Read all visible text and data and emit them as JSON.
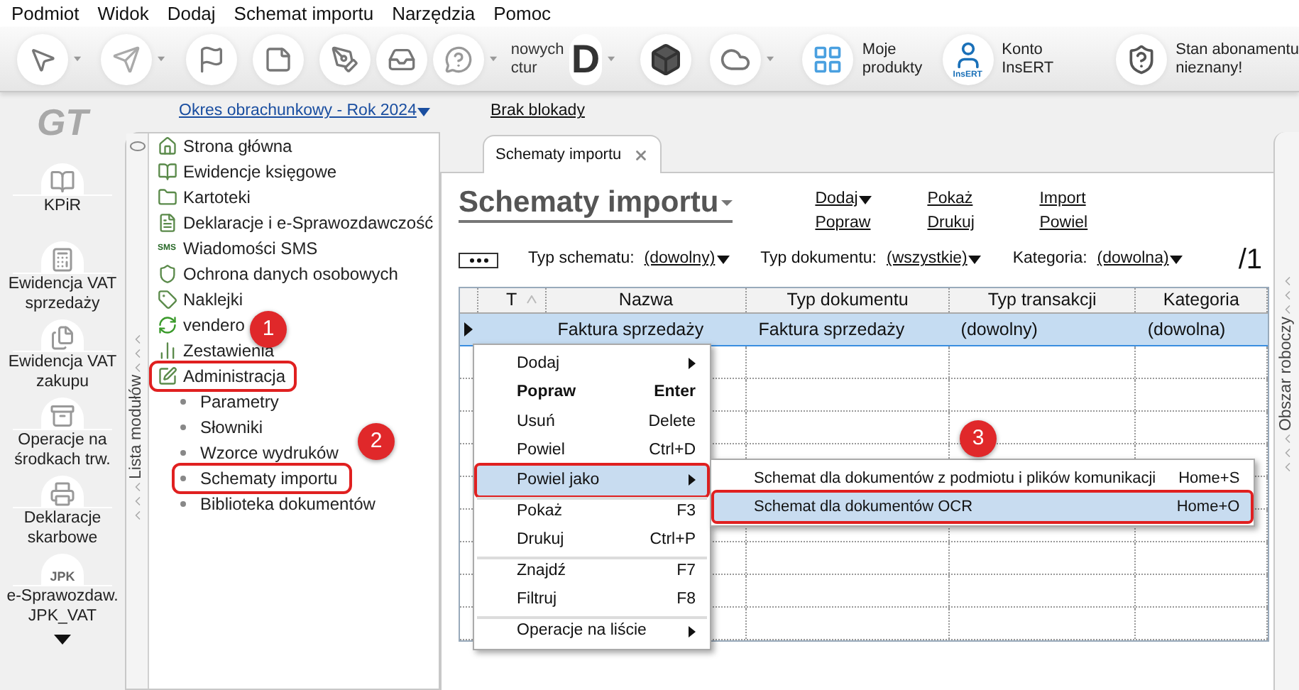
{
  "menu_bar": [
    "Podmiot",
    "Widok",
    "Dodaj",
    "Schemat importu",
    "Narzędzia",
    "Pomoc"
  ],
  "toolbar": {
    "partial_label": [
      "nowych",
      "ctur"
    ],
    "letter_button": "D",
    "labeled_buttons": [
      {
        "lines": [
          "Moje",
          "produkty"
        ]
      },
      {
        "lines": [
          "Konto",
          "InsERT"
        ],
        "icon_text": "InsERT"
      },
      {
        "lines": [
          "Stan abonamentu",
          "nieznany!"
        ]
      }
    ]
  },
  "sidebar": {
    "logo": "GT",
    "modules": [
      {
        "lines": [
          "KPiR"
        ]
      },
      {
        "lines": [
          "Ewidencja VAT",
          "sprzedaży"
        ]
      },
      {
        "lines": [
          "Ewidencja VAT",
          "zakupu"
        ]
      },
      {
        "lines": [
          "Operacje na",
          "środkach trw."
        ]
      },
      {
        "lines": [
          "Deklaracje",
          "skarbowe"
        ]
      },
      {
        "lines": [
          "e-Sprawozdaw.",
          "JPK_VAT"
        ],
        "icon_text": "JPK"
      }
    ]
  },
  "header": {
    "period_link": "Okres obrachunkowy - Rok 2024",
    "lock_link": "Brak blokady"
  },
  "module_panel": {
    "title": "Lista modułów",
    "tree": [
      {
        "label": "Strona główna",
        "highlighted": false
      },
      {
        "label": "Ewidencje księgowe",
        "highlighted": false
      },
      {
        "label": "Kartoteki",
        "highlighted": false
      },
      {
        "label": "Deklaracje i e-Sprawozdawczość",
        "highlighted": false
      },
      {
        "label": "Wiadomości SMS",
        "highlighted": false,
        "icon_text": "SMS"
      },
      {
        "label": "Ochrona danych osobowych",
        "highlighted": false
      },
      {
        "label": "Naklejki",
        "highlighted": false
      },
      {
        "label": "vendero",
        "highlighted": false
      },
      {
        "label": "Zestawienia",
        "highlighted": false
      },
      {
        "label": "Administracja",
        "highlighted": true,
        "children": [
          {
            "label": "Parametry",
            "highlighted": false
          },
          {
            "label": "Słowniki",
            "highlighted": false
          },
          {
            "label": "Wzorce wydruków",
            "highlighted": false
          },
          {
            "label": "Schematy importu",
            "highlighted": true
          },
          {
            "label": "Biblioteka dokumentów",
            "highlighted": false
          }
        ]
      }
    ]
  },
  "tabs": [
    {
      "label": "Schematy importu",
      "selected": true
    }
  ],
  "page": {
    "title": "Schematy importu",
    "actions": [
      [
        {
          "label": "Dodaj",
          "dropdown": true
        },
        {
          "label": "Popraw",
          "dropdown": false
        }
      ],
      [
        {
          "label": "Pokaż",
          "dropdown": false
        },
        {
          "label": "Drukuj",
          "dropdown": false
        }
      ],
      [
        {
          "label": "Import",
          "dropdown": false
        },
        {
          "label": "Powiel",
          "dropdown": false
        }
      ]
    ],
    "filters": [
      {
        "label": "Typ schematu:",
        "value": "(dowolny)"
      },
      {
        "label": "Typ dokumentu:",
        "value": "(wszystkie)"
      },
      {
        "label": "Kategoria:",
        "value": "(dowolna)"
      }
    ],
    "page_count": "/1"
  },
  "table": {
    "columns": [
      "T",
      "Nazwa",
      "Typ dokumentu",
      "Typ transakcji",
      "Kategoria"
    ],
    "rows": [
      {
        "cells": [
          "",
          "Faktura sprzedaży",
          "Faktura sprzedaży",
          "(dowolny)",
          "(dowolna)"
        ],
        "selected": true
      }
    ]
  },
  "context_menu": [
    {
      "label": "Dodaj",
      "submenu": true,
      "bold": false,
      "selected": false,
      "highlighted": false,
      "separator_before": false
    },
    {
      "label": "Popraw",
      "shortcut": "Enter",
      "submenu": false,
      "bold": true,
      "selected": false,
      "highlighted": false,
      "separator_before": false
    },
    {
      "label": "Usuń",
      "shortcut": "Delete",
      "submenu": false,
      "bold": false,
      "selected": false,
      "highlighted": false,
      "separator_before": false
    },
    {
      "label": "Powiel",
      "shortcut": "Ctrl+D",
      "submenu": false,
      "bold": false,
      "selected": false,
      "highlighted": false,
      "separator_before": false
    },
    {
      "label": "Powiel jako",
      "submenu": true,
      "bold": false,
      "selected": true,
      "highlighted": true,
      "separator_before": false
    },
    {
      "label": "Pokaż",
      "shortcut": "F3",
      "submenu": false,
      "bold": false,
      "selected": false,
      "highlighted": false,
      "separator_before": true
    },
    {
      "label": "Drukuj",
      "shortcut": "Ctrl+P",
      "submenu": false,
      "bold": false,
      "selected": false,
      "highlighted": false,
      "separator_before": false
    },
    {
      "label": "Znajdź",
      "shortcut": "F7",
      "submenu": false,
      "bold": false,
      "selected": false,
      "highlighted": false,
      "separator_before": true
    },
    {
      "label": "Filtruj",
      "shortcut": "F8",
      "submenu": false,
      "bold": false,
      "selected": false,
      "highlighted": false,
      "separator_before": false
    },
    {
      "label": "Operacje na liście",
      "submenu": true,
      "bold": false,
      "selected": false,
      "highlighted": false,
      "separator_before": true
    }
  ],
  "submenu": [
    {
      "label": "Schemat dla dokumentów z podmiotu i plików komunikacji",
      "shortcut": "Home+S",
      "selected": false,
      "highlighted": false
    },
    {
      "label": "Schemat dla dokumentów OCR",
      "shortcut": "Home+O",
      "selected": true,
      "highlighted": true
    }
  ],
  "right_panel": {
    "title": "Obszar roboczy"
  },
  "annotations": [
    "1",
    "2",
    "3"
  ]
}
